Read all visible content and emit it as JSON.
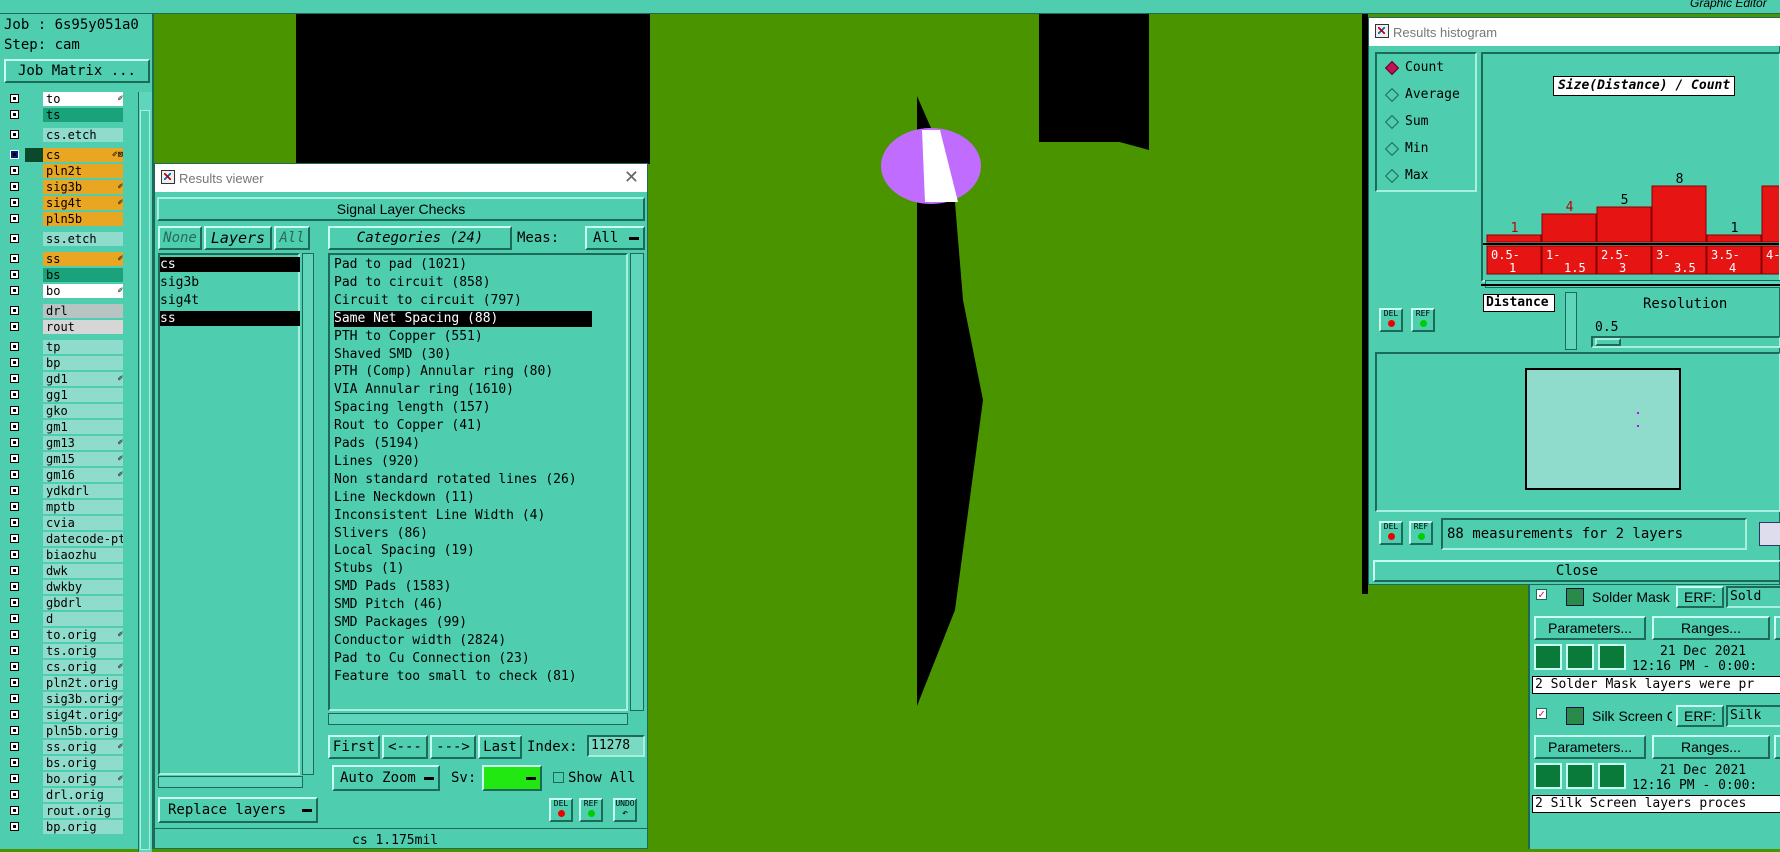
{
  "top": {
    "graphic_title": "Graphic Editor"
  },
  "job": {
    "job_label": "Job : 6s95y051a0",
    "step_label": "Step: cam",
    "matrix_button": "Job Matrix ..."
  },
  "layers": [
    {
      "name": "to",
      "color": "#ffffff",
      "mark": "✐"
    },
    {
      "name": "ts",
      "color": "#1aa37a",
      "mark": ""
    },
    {
      "name": "cs.etch",
      "color": "#8fdccc",
      "mark": ""
    },
    {
      "name": "cs",
      "color": "#e8a623",
      "mark": "✐⊠",
      "active": true
    },
    {
      "name": "pln2t",
      "color": "#e8a623",
      "mark": ""
    },
    {
      "name": "sig3b",
      "color": "#e8a623",
      "mark": "✐"
    },
    {
      "name": "sig4t",
      "color": "#e8a623",
      "mark": "✐"
    },
    {
      "name": "pln5b",
      "color": "#e8a623",
      "mark": ""
    },
    {
      "name": "ss.etch",
      "color": "#8fdccc",
      "mark": ""
    },
    {
      "name": "ss",
      "color": "#e8a623",
      "mark": "✐"
    },
    {
      "name": "bs",
      "color": "#1aa37a",
      "mark": ""
    },
    {
      "name": "bo",
      "color": "#ffffff",
      "mark": "✐"
    },
    {
      "name": "drl",
      "color": "#b7c4c2",
      "mark": ""
    },
    {
      "name": "rout",
      "color": "#d6d6d6",
      "mark": ""
    },
    {
      "name": "tp",
      "color": "#8fdccc",
      "mark": ""
    },
    {
      "name": "bp",
      "color": "#8fdccc",
      "mark": ""
    },
    {
      "name": "gd1",
      "color": "#8fdccc",
      "mark": "✐"
    },
    {
      "name": "gg1",
      "color": "#8fdccc",
      "mark": ""
    },
    {
      "name": "gko",
      "color": "#8fdccc",
      "mark": ""
    },
    {
      "name": "gm1",
      "color": "#8fdccc",
      "mark": ""
    },
    {
      "name": "gm13",
      "color": "#8fdccc",
      "mark": "✐"
    },
    {
      "name": "gm15",
      "color": "#8fdccc",
      "mark": "✐"
    },
    {
      "name": "gm16",
      "color": "#8fdccc",
      "mark": "✐"
    },
    {
      "name": "ydkdrl",
      "color": "#8fdccc",
      "mark": ""
    },
    {
      "name": "mptb",
      "color": "#8fdccc",
      "mark": ""
    },
    {
      "name": "cvia",
      "color": "#8fdccc",
      "mark": ""
    },
    {
      "name": "datecode-pt",
      "color": "#8fdccc",
      "mark": ""
    },
    {
      "name": "biaozhu",
      "color": "#8fdccc",
      "mark": ""
    },
    {
      "name": "dwk",
      "color": "#8fdccc",
      "mark": ""
    },
    {
      "name": "dwkby",
      "color": "#8fdccc",
      "mark": ""
    },
    {
      "name": "gbdrl",
      "color": "#8fdccc",
      "mark": ""
    },
    {
      "name": "d",
      "color": "#8fdccc",
      "mark": ""
    },
    {
      "name": "to.orig",
      "color": "#8fdccc",
      "mark": "✐"
    },
    {
      "name": "ts.orig",
      "color": "#8fdccc",
      "mark": ""
    },
    {
      "name": "cs.orig",
      "color": "#8fdccc",
      "mark": "✐"
    },
    {
      "name": "pln2t.orig",
      "color": "#8fdccc",
      "mark": ""
    },
    {
      "name": "sig3b.orig",
      "color": "#8fdccc",
      "mark": "✐"
    },
    {
      "name": "sig4t.orig",
      "color": "#8fdccc",
      "mark": "✐"
    },
    {
      "name": "pln5b.orig",
      "color": "#8fdccc",
      "mark": ""
    },
    {
      "name": "ss.orig",
      "color": "#8fdccc",
      "mark": "✐"
    },
    {
      "name": "bs.orig",
      "color": "#8fdccc",
      "mark": ""
    },
    {
      "name": "bo.orig",
      "color": "#8fdccc",
      "mark": "✐"
    },
    {
      "name": "drl.orig",
      "color": "#8fdccc",
      "mark": ""
    },
    {
      "name": "rout.orig",
      "color": "#8fdccc",
      "mark": ""
    },
    {
      "name": "bp.orig",
      "color": "#8fdccc",
      "mark": ""
    }
  ],
  "results_viewer": {
    "title": "Results viewer",
    "header": "Signal Layer Checks",
    "none_btn": "None",
    "layers_btn": "Layers",
    "all_btn": "All",
    "layer_items": [
      "cs",
      "sig3b",
      "sig4t",
      "ss"
    ],
    "categories_btn": "Categories (24)",
    "meas_label": "Meas:",
    "meas_value": "All",
    "categories": [
      "Pad to pad (1021)",
      "Pad to circuit (858)",
      "Circuit to circuit (797)",
      "Same Net Spacing (88)",
      "PTH to Copper (551)",
      "Shaved SMD (30)",
      "PTH (Comp) Annular ring (80)",
      "VIA Annular ring (1610)",
      "Spacing length (157)",
      "Rout to Copper (41)",
      "Pads (5194)",
      "Lines (920)",
      "Non standard rotated lines (26)",
      "Line Neckdown (11)",
      "Inconsistent Line Width (4)",
      "Slivers (86)",
      "Local Spacing (19)",
      "Stubs (1)",
      "SMD Pads (1583)",
      "SMD Pitch (46)",
      "SMD Packages (99)",
      "Conductor width (2824)",
      "Pad to Cu Connection (23)",
      "Feature too small to check (81)"
    ],
    "first_btn": "First",
    "prev_btn": "<---",
    "next_btn": "--->",
    "last_btn": "Last",
    "index_label": "Index:",
    "index_value": "11278",
    "zoom_value": "Auto Zoom",
    "sv_label": "Sv:",
    "show_all": "Show All",
    "replace_btn": "Replace layers",
    "del": "DEL",
    "ref": "REF",
    "undo": "UNDO",
    "status": "cs 1.175mil"
  },
  "histogram": {
    "title": "Results histogram",
    "modes": [
      "Count",
      "Average",
      "Sum",
      "Min",
      "Max"
    ],
    "selected_mode": "Count",
    "chart_title": "Size(Distance) / Count",
    "distance_label": "Distance",
    "resolution_label": "Resolution",
    "resolution_value": "0.5",
    "measure_text": "88 measurements for 2 layers",
    "close_btn": "Close",
    "del": "DEL",
    "ref": "REF"
  },
  "chart_data": {
    "type": "bar",
    "title": "Size(Distance) / Count",
    "categories": [
      "0.5-1",
      "1-1.5",
      "2.5-3",
      "3-3.5",
      "3.5-4",
      "4-"
    ],
    "values": [
      1,
      4,
      5,
      8,
      1,
      null
    ],
    "value_labels": [
      "1",
      "4",
      "5",
      "8",
      "1",
      ""
    ],
    "label_colors": [
      "#c00000",
      "#c00000",
      "#000000",
      "#000000",
      "#000000",
      "#000000"
    ]
  },
  "checks": [
    {
      "name": "Solder Mask Ch",
      "erf_label": "ERF:",
      "erf_value": "Sold",
      "params": "Parameters...",
      "ranges": "Ranges...",
      "date": "21 Dec 2021",
      "time": "12:16 PM - 0:00:",
      "message": "2 Solder Mask layers were pr"
    },
    {
      "name": "Silk Screen Che",
      "erf_label": "ERF:",
      "erf_value": "Silk",
      "params": "Parameters...",
      "ranges": "Ranges...",
      "date": "21 Dec 2021",
      "time": "12:16 PM - 0:00:",
      "message": "2 Silk Screen layers proces"
    }
  ],
  "colors": {
    "canvas_green": "#4a9400",
    "panel": "#4ecdaf",
    "highlight": "#c06cff"
  }
}
